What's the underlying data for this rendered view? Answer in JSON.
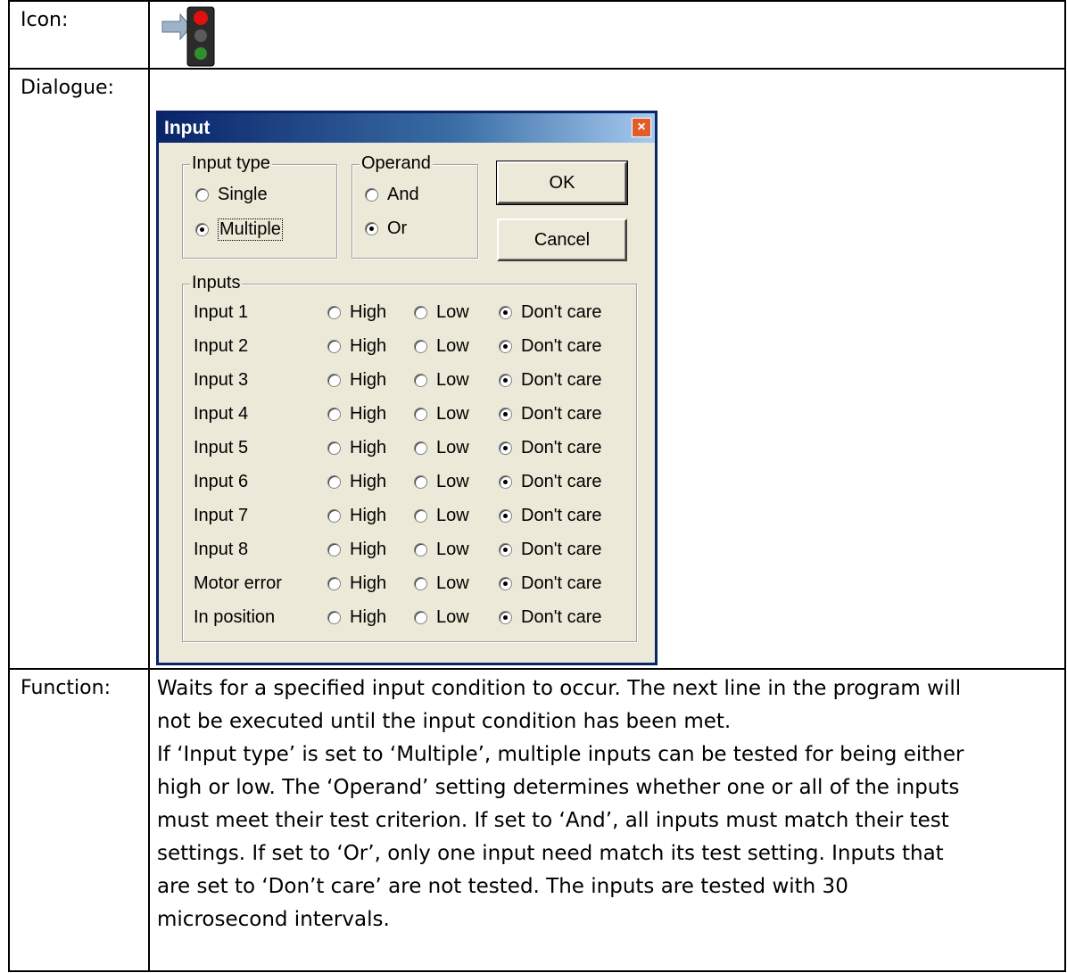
{
  "table": {
    "icon_label": "Icon:",
    "dialogue_label": "Dialogue:",
    "function_label": "Function:",
    "function_text": [
      "Waits for a specified input condition to occur. The next line in the program will",
      "not be executed until the input condition has been met.",
      "If ‘Input type’ is set to ‘Multiple’, multiple inputs can be tested for being either",
      "high or low. The ‘Operand’ setting determines whether one or all of the inputs",
      "must meet their test criterion. If set to ‘And’, all inputs must match their test",
      "settings. If set to ‘Or’, only one input need match its test setting. Inputs that",
      "are set to ‘Don’t care’ are not tested. The inputs are tested with 30",
      "microsecond intervals."
    ]
  },
  "icon": {
    "name": "traffic-light-icon"
  },
  "dialog": {
    "title": "Input",
    "close_glyph": "×",
    "input_type": {
      "title": "Input type",
      "single": "Single",
      "multiple": "Multiple",
      "selected": "Multiple"
    },
    "operand": {
      "title": "Operand",
      "and": "And",
      "or": "Or",
      "selected": "Or"
    },
    "ok_label": "OK",
    "cancel_label": "Cancel",
    "inputs_title": "Inputs",
    "option_labels": {
      "high": "High",
      "low": "Low",
      "dont_care": "Don't care"
    },
    "inputs": [
      {
        "label": "Input 1",
        "selected": "dont_care"
      },
      {
        "label": "Input 2",
        "selected": "dont_care"
      },
      {
        "label": "Input 3",
        "selected": "dont_care"
      },
      {
        "label": "Input 4",
        "selected": "dont_care"
      },
      {
        "label": "Input 5",
        "selected": "dont_care"
      },
      {
        "label": "Input 6",
        "selected": "dont_care"
      },
      {
        "label": "Input 7",
        "selected": "dont_care"
      },
      {
        "label": "Input 8",
        "selected": "dont_care"
      },
      {
        "label": "Motor error",
        "selected": "dont_care"
      },
      {
        "label": "In position",
        "selected": "dont_care"
      }
    ]
  }
}
